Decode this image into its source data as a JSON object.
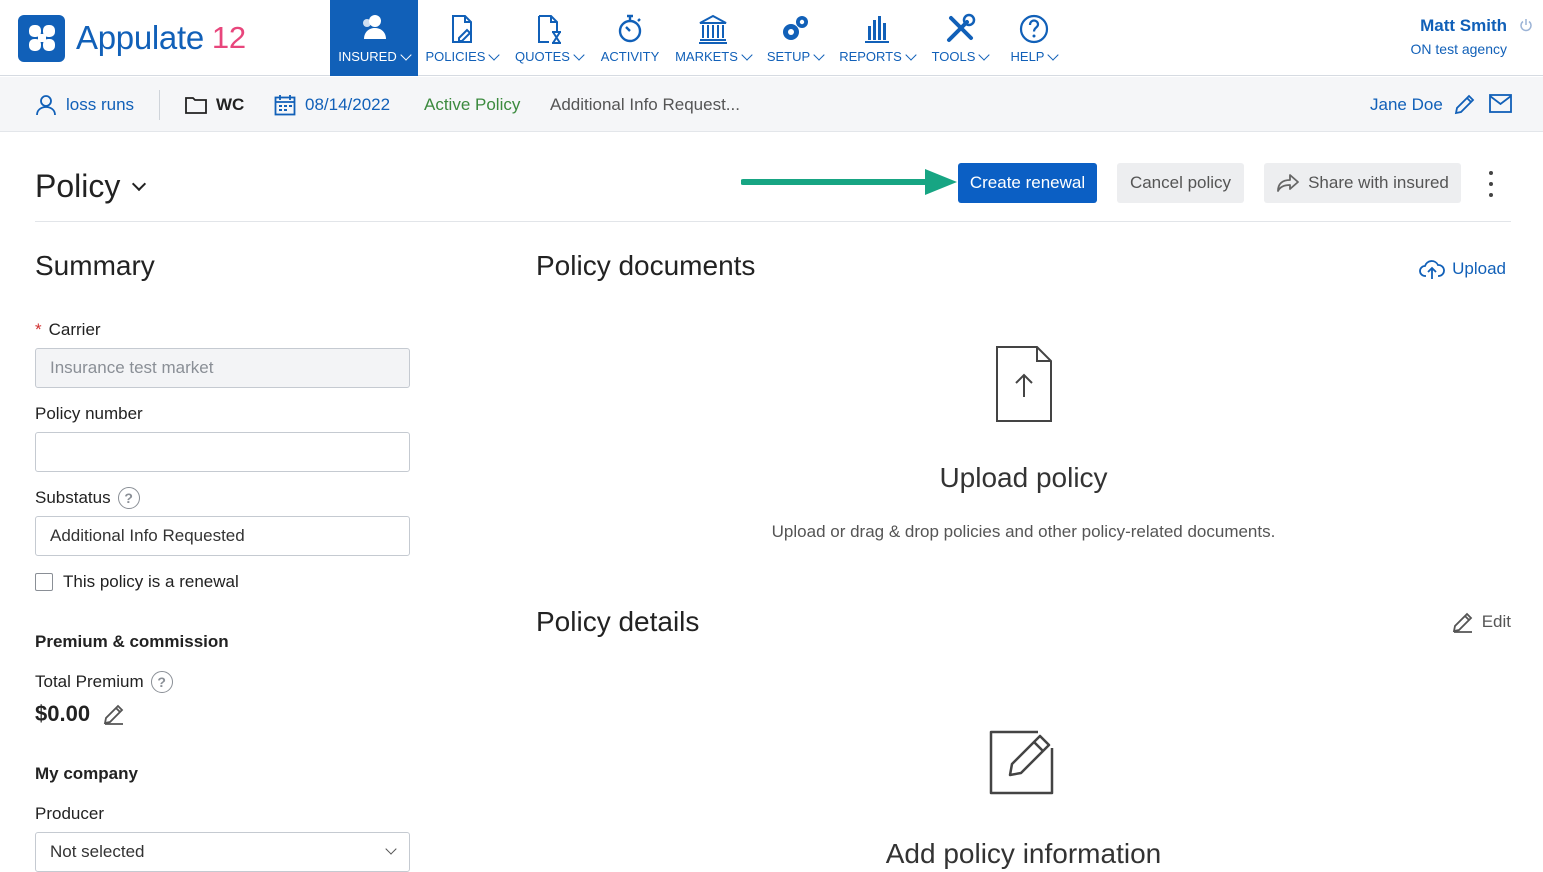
{
  "app": {
    "name": "Appulate",
    "version": "12"
  },
  "nav": [
    {
      "key": "insured",
      "label": "INSURED",
      "chevron": true,
      "icon": "insured-icon",
      "active": true
    },
    {
      "key": "policies",
      "label": "POLICIES",
      "chevron": true,
      "icon": "policy-document-icon"
    },
    {
      "key": "quotes",
      "label": "QUOTES",
      "chevron": true,
      "icon": "quote-hourglass-icon"
    },
    {
      "key": "activity",
      "label": "ACTIVITY",
      "chevron": false,
      "icon": "stopwatch-icon"
    },
    {
      "key": "markets",
      "label": "MARKETS",
      "chevron": true,
      "icon": "bank-icon"
    },
    {
      "key": "setup",
      "label": "SETUP",
      "chevron": true,
      "icon": "gears-icon"
    },
    {
      "key": "reports",
      "label": "REPORTS",
      "chevron": true,
      "icon": "bar-chart-icon"
    },
    {
      "key": "tools",
      "label": "TOOLS",
      "chevron": true,
      "icon": "tools-icon"
    },
    {
      "key": "help",
      "label": "HELP",
      "chevron": true,
      "icon": "question-circle-icon"
    }
  ],
  "user": {
    "name": "Matt Smith",
    "agency": "ON test agency"
  },
  "subbar": {
    "insured": "loss runs",
    "line": "WC",
    "date": "08/14/2022",
    "status": "Active Policy",
    "substatus": "Additional Info Request...",
    "assignee": "Jane Doe"
  },
  "page": {
    "title": "Policy",
    "create_renewal": "Create renewal",
    "cancel_policy": "Cancel policy",
    "share": "Share with insured"
  },
  "summary": {
    "title": "Summary",
    "carrier_label": "Carrier",
    "carrier_value": "Insurance test market",
    "policy_number_label": "Policy number",
    "policy_number_value": "",
    "substatus_label": "Substatus",
    "substatus_value": "Additional Info Requested",
    "renewal_checkbox": "This policy is a renewal",
    "premium_section": "Premium & commission",
    "total_premium_label": "Total Premium",
    "total_premium_value": "$0.00",
    "my_company": "My company",
    "producer_label": "Producer",
    "producer_value": "Not selected"
  },
  "documents": {
    "title": "Policy documents",
    "upload_link": "Upload",
    "upload_heading": "Upload policy",
    "upload_hint": "Upload or drag & drop policies and other policy-related documents."
  },
  "details": {
    "title": "Policy details",
    "edit_link": "Edit",
    "add_heading": "Add policy information"
  },
  "colors": {
    "primary": "#1160b8",
    "accent": "#e8467c",
    "status_green": "#3b8a3e",
    "arrow": "#17a583"
  }
}
